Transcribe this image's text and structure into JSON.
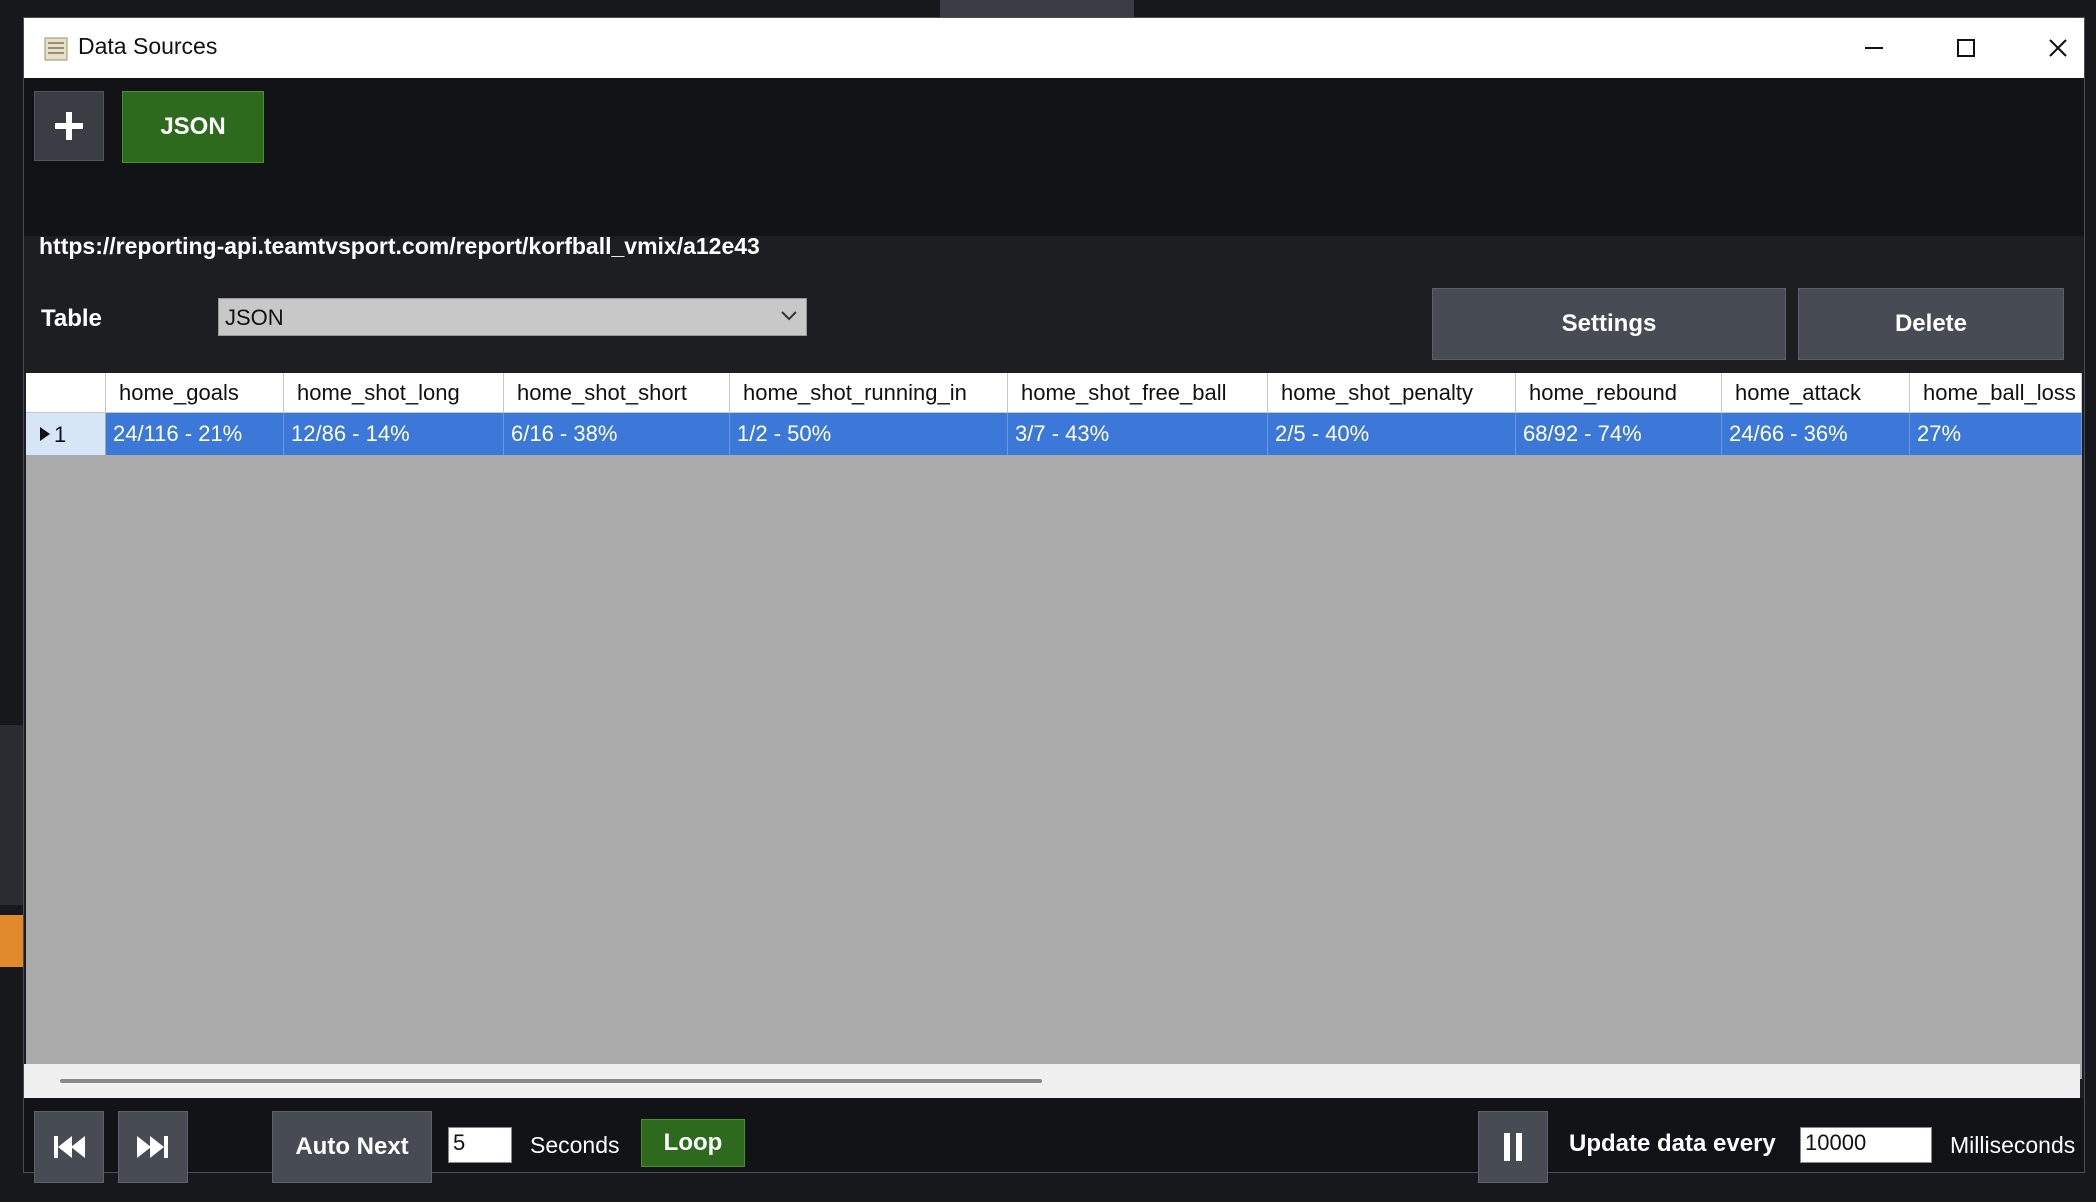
{
  "window": {
    "title": "Data Sources",
    "app_icon": "data-sources-icon"
  },
  "toolbar": {
    "add_icon": "plus-icon",
    "source_tab_label": "JSON"
  },
  "source": {
    "url": "https://reporting-api.teamtvsport.com/report/korfball_vmix/a12e43",
    "table_label": "Table",
    "table_selected": "JSON",
    "settings_label": "Settings",
    "delete_label": "Delete"
  },
  "grid": {
    "columns": [
      "home_goals",
      "home_shot_long",
      "home_shot_short",
      "home_shot_running_in",
      "home_shot_free_ball",
      "home_shot_penalty",
      "home_rebound",
      "home_attack",
      "home_ball_loss"
    ],
    "rows": [
      {
        "index": "1",
        "cells": [
          "24/116 - 21%",
          "12/86 - 14%",
          "6/16 - 38%",
          "1/2 - 50%",
          "3/7 - 43%",
          "2/5 - 40%",
          "68/92 - 74%",
          "24/66 - 36%",
          "27%"
        ]
      }
    ],
    "selected_row_color": "#3b78d8"
  },
  "footer": {
    "first_icon": "skip-to-start-icon",
    "last_icon": "skip-to-end-icon",
    "auto_next_label": "Auto Next",
    "auto_next_seconds": "5",
    "seconds_label": "Seconds",
    "loop_label": "Loop",
    "pause_icon": "pause-icon",
    "update_label": "Update data every",
    "update_value": "10000",
    "ms_label": "Milliseconds"
  },
  "colors": {
    "accent_green": "#2e6a1d",
    "selection_blue": "#3b78d8",
    "background": "#1c1e22"
  }
}
